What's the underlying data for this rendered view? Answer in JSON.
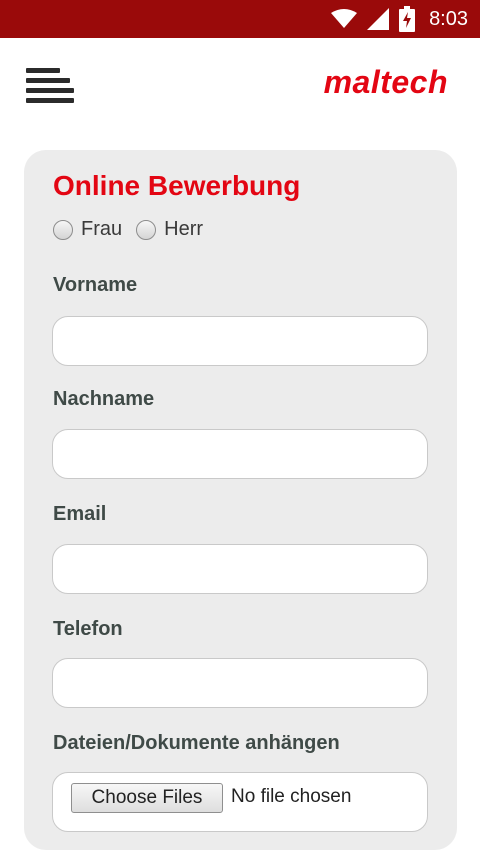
{
  "status_bar": {
    "time": "8:03",
    "icons": [
      "wifi-icon",
      "cellular-signal-icon",
      "battery-charging-icon"
    ]
  },
  "header": {
    "menu_icon": "hamburger-menu-icon",
    "logo_text": "maltech"
  },
  "form": {
    "title": "Online Bewerbung",
    "salutation_options": [
      {
        "label": "Frau",
        "checked": false
      },
      {
        "label": "Herr",
        "checked": false
      }
    ],
    "fields": {
      "first_name": {
        "label": "Vorname",
        "value": "",
        "placeholder": ""
      },
      "last_name": {
        "label": "Nachname",
        "value": "",
        "placeholder": ""
      },
      "email": {
        "label": "Email",
        "value": "",
        "placeholder": ""
      },
      "phone": {
        "label": "Telefon",
        "value": "",
        "placeholder": ""
      }
    },
    "attachments": {
      "label": "Dateien/Dokumente anhängen",
      "button_label": "Choose Files",
      "status": "No file chosen"
    }
  },
  "colors": {
    "status_bar_bg": "#9a0a0a",
    "brand_red": "#e30613",
    "card_bg": "#ececec",
    "label_color": "#3f4a47"
  }
}
